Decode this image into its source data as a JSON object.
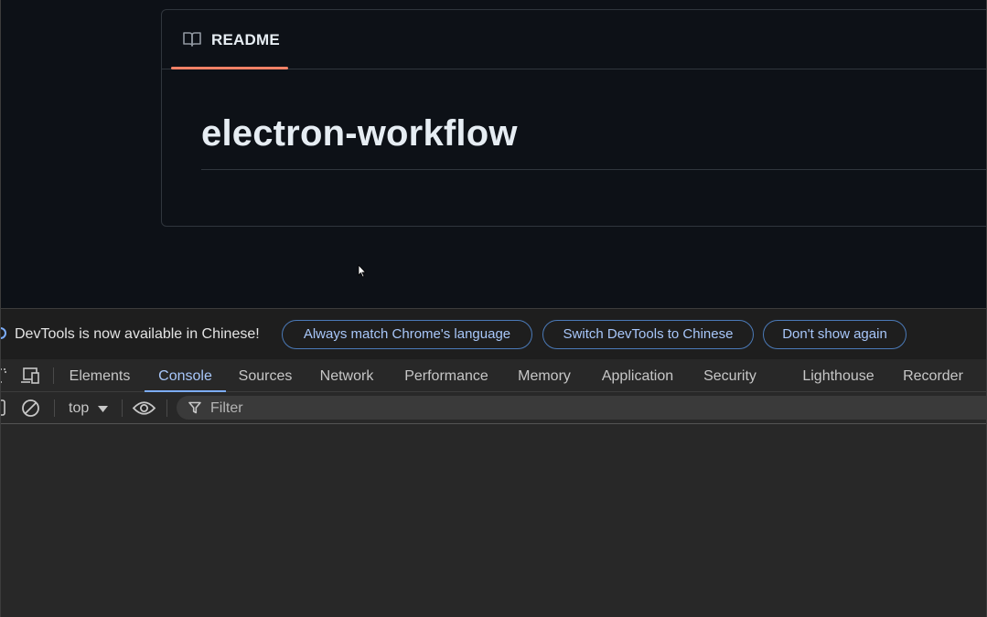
{
  "readme": {
    "tab_label": "README",
    "title": "electron-workflow"
  },
  "devtools": {
    "infobar": {
      "message": "DevTools is now available in Chinese!",
      "buttons": [
        "Always match Chrome's language",
        "Switch DevTools to Chinese",
        "Don't show again"
      ]
    },
    "tabs": [
      "Elements",
      "Console",
      "Sources",
      "Network",
      "Performance",
      "Memory",
      "Application",
      "Security",
      "Lighthouse",
      "Recorder"
    ],
    "active_tab": "Console",
    "toolbar": {
      "context": "top",
      "filter_placeholder": "Filter"
    }
  },
  "colors": {
    "accent_underline": "#f78166",
    "devtools_accent": "#7cacf8"
  }
}
